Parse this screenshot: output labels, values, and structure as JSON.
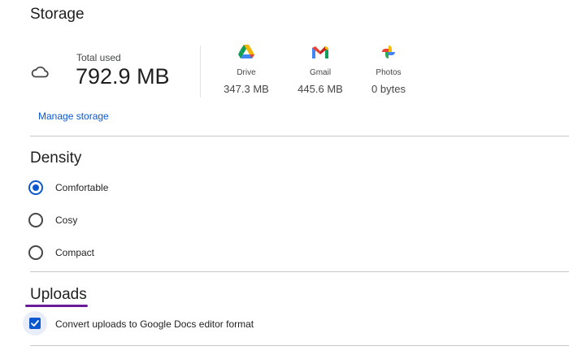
{
  "storage": {
    "title": "Storage",
    "total_label": "Total used",
    "total_value": "792.9 MB",
    "manage_link": "Manage storage",
    "services": [
      {
        "name": "Drive",
        "value": "347.3 MB",
        "icon": "google-drive-icon"
      },
      {
        "name": "Gmail",
        "value": "445.6 MB",
        "icon": "gmail-icon"
      },
      {
        "name": "Photos",
        "value": "0 bytes",
        "icon": "google-photos-icon"
      }
    ]
  },
  "density": {
    "title": "Density",
    "options": [
      {
        "label": "Comfortable",
        "selected": true
      },
      {
        "label": "Cosy",
        "selected": false
      },
      {
        "label": "Compact",
        "selected": false
      }
    ]
  },
  "uploads": {
    "title": "Uploads",
    "convert_label": "Convert uploads to Google Docs editor format",
    "convert_checked": true
  },
  "colors": {
    "accent": "#0b57d0",
    "link": "#0b57d0",
    "divider": "#c4c7c5",
    "highlight_underline": "#6a1b9a"
  }
}
